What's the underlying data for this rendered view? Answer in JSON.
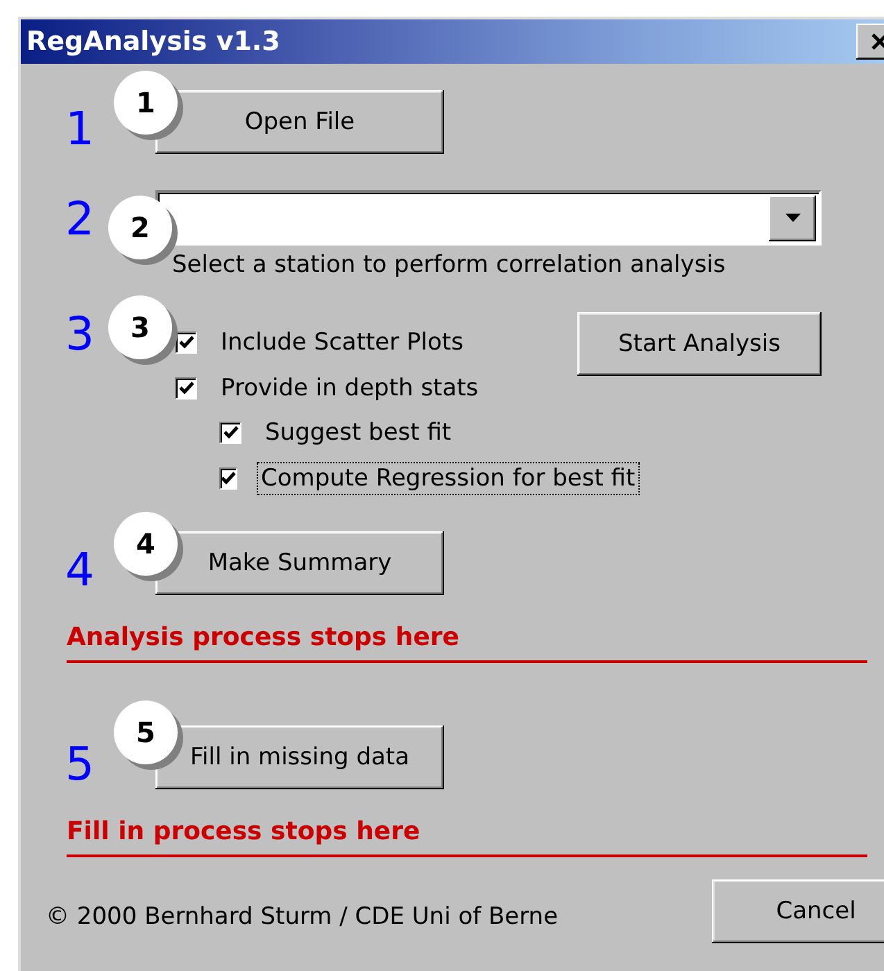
{
  "window": {
    "title": "RegAnalysis v1.3"
  },
  "steps": [
    {
      "number": "1",
      "callout": "1",
      "kind": "button",
      "button": "Open File"
    },
    {
      "number": "2",
      "callout": "2",
      "kind": "combo",
      "hint": "Select a station to perform correlation analysis"
    },
    {
      "number": "3",
      "callout": "3",
      "kind": "options",
      "button": "Start Analysis",
      "options": [
        {
          "label": "Include Scatter Plots",
          "checked": true,
          "focused": false
        },
        {
          "label": "Provide in depth stats",
          "checked": true,
          "focused": false,
          "children": [
            {
              "label": "Suggest best fit",
              "checked": true,
              "focused": false
            },
            {
              "label": "Compute Regression for best fit",
              "checked": true,
              "focused": true
            }
          ]
        }
      ]
    },
    {
      "number": "4",
      "callout": "4",
      "kind": "button",
      "button": "Make Summary",
      "stop_note": "Analysis process stops here"
    },
    {
      "number": "5",
      "callout": "5",
      "kind": "button",
      "button": "Fill in missing data",
      "stop_note": "Fill in process stops here"
    }
  ],
  "footer": {
    "copyright": "© 2000 Bernhard Sturm / CDE Uni of Berne",
    "cancel": "Cancel"
  }
}
